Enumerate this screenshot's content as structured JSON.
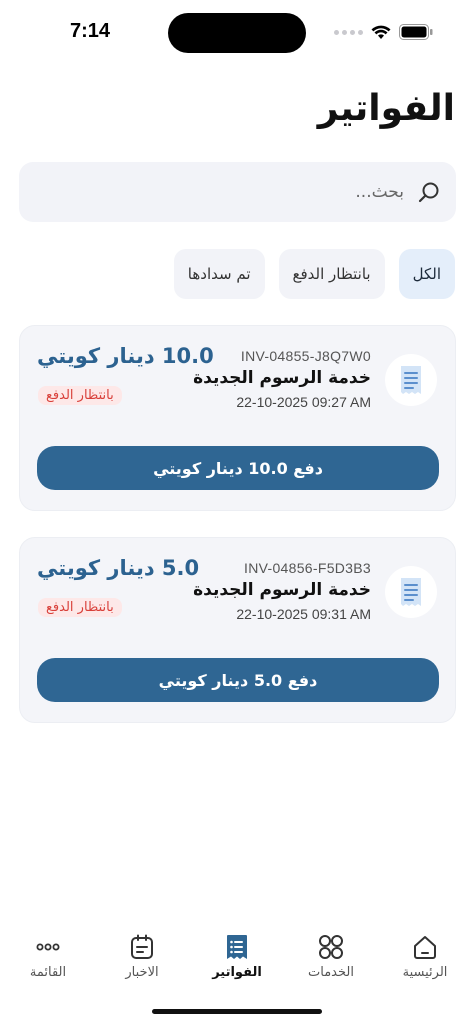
{
  "status_bar": {
    "time": "7:14"
  },
  "page": {
    "title": "الفواتير"
  },
  "search": {
    "placeholder": "بحث..."
  },
  "filters": [
    {
      "label": "الكل",
      "active": true
    },
    {
      "label": "بانتظار الدفع",
      "active": false
    },
    {
      "label": "تم سدادها",
      "active": false
    }
  ],
  "invoices": [
    {
      "number": "INV-04855-J8Q7W0",
      "service": "خدمة الرسوم الجديدة",
      "date": "22-10-2025 09:27 AM",
      "amount": "10.0 دينار كويتي",
      "status": "بانتظار الدفع",
      "pay_label": "دفع 10.0 دينار كويتي"
    },
    {
      "number": "INV-04856-F5D3B3",
      "service": "خدمة الرسوم الجديدة",
      "date": "22-10-2025 09:31 AM",
      "amount": "5.0 دينار كويتي",
      "status": "بانتظار الدفع",
      "pay_label": "دفع 5.0 دينار كويتي"
    }
  ],
  "nav": {
    "home": "الرئيسية",
    "services": "الخدمات",
    "invoices": "الفواتير",
    "news": "الاخبار",
    "menu": "القائمة"
  },
  "colors": {
    "accent": "#2f6693",
    "amount": "#2c6290",
    "status_text": "#d9403a",
    "status_bg": "#fde8e8",
    "card_bg": "#f4f5f9",
    "chip_active_bg": "#e4eefa"
  }
}
